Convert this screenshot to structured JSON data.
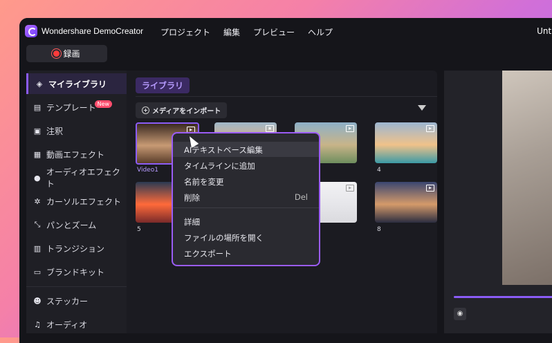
{
  "app": {
    "name": "Wondershare DemoCreator",
    "doc_title": "Untitle"
  },
  "menu": [
    "プロジェクト",
    "編集",
    "プレビュー",
    "ヘルプ"
  ],
  "record_button": "録画",
  "sidebar": [
    {
      "label": "マイライブラリ",
      "icon": "layers-icon"
    },
    {
      "label": "テンプレート",
      "icon": "template-icon",
      "badge": "New"
    },
    {
      "label": "注釈",
      "icon": "annotation-icon"
    },
    {
      "label": "動画エフェクト",
      "icon": "video-effect-icon"
    },
    {
      "label": "オーディオエフェクト",
      "icon": "audio-effect-icon"
    },
    {
      "label": "カーソルエフェクト",
      "icon": "cursor-effect-icon"
    },
    {
      "label": "パンとズーム",
      "icon": "pan-zoom-icon"
    },
    {
      "label": "トランジション",
      "icon": "transition-icon"
    },
    {
      "label": "ブランドキット",
      "icon": "brand-kit-icon"
    },
    {
      "label": "ステッカー",
      "icon": "sticker-icon"
    },
    {
      "label": "オーディオ",
      "icon": "music-icon"
    }
  ],
  "library": {
    "tab": "ライブラリ",
    "import_button": "メディアをインポート",
    "items": [
      {
        "label": "Video1",
        "colors": [
          "#3a2a22",
          "#c79a74",
          "#5a3d2a"
        ]
      },
      {
        "label": "",
        "colors": [
          "#9fb7c9",
          "#e7b07a",
          "#4f8a97"
        ]
      },
      {
        "label": "",
        "colors": [
          "#8db0c8",
          "#c8b489",
          "#6e8e5e"
        ]
      },
      {
        "label": "4",
        "colors": [
          "#9cb6d1",
          "#f0c28a",
          "#3b9aa5"
        ]
      },
      {
        "label": "5",
        "colors": [
          "#2b3a52",
          "#ff6a3a",
          "#7a2a2a"
        ]
      },
      {
        "label": "",
        "colors": [
          "#f2f2f4",
          "#e6e6ea",
          "#dadade"
        ]
      },
      {
        "label": "8",
        "colors": [
          "#3a4670",
          "#d49a6a",
          "#2b2d40"
        ]
      }
    ]
  },
  "context_menu": [
    {
      "label": "AIテキストベース編集"
    },
    {
      "label": "タイムラインに追加"
    },
    {
      "label": "名前を変更"
    },
    {
      "label": "削除",
      "shortcut": "Del"
    },
    {
      "label": "詳細"
    },
    {
      "label": "ファイルの場所を開く"
    },
    {
      "label": "エクスポート"
    }
  ]
}
